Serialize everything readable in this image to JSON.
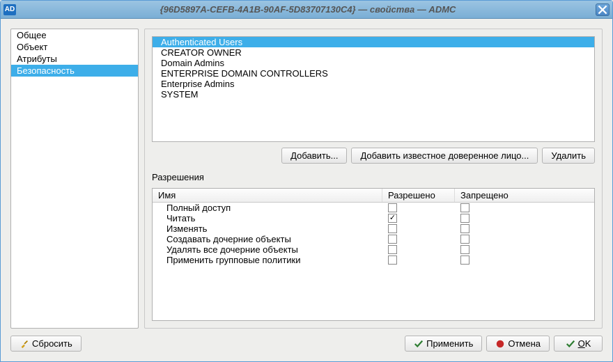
{
  "title": "{96D5897A-CEFB-4A1B-90AF-5D83707130C4} — свойства — ADMC",
  "app_icon_text": "AD",
  "sidebar": {
    "items": [
      {
        "label": "Общее",
        "selected": false
      },
      {
        "label": "Объект",
        "selected": false
      },
      {
        "label": "Атрибуты",
        "selected": false
      },
      {
        "label": "Безопасность",
        "selected": true
      }
    ]
  },
  "principals": [
    {
      "name": "Authenticated Users",
      "selected": true
    },
    {
      "name": "CREATOR OWNER",
      "selected": false
    },
    {
      "name": "Domain Admins",
      "selected": false
    },
    {
      "name": "ENTERPRISE DOMAIN CONTROLLERS",
      "selected": false
    },
    {
      "name": "Enterprise Admins",
      "selected": false
    },
    {
      "name": "SYSTEM",
      "selected": false
    }
  ],
  "principal_buttons": {
    "add": "Добавить...",
    "add_wellknown": "Добавить известное доверенное лицо...",
    "remove": "Удалить"
  },
  "permissions_label": "Разрешения",
  "perm_columns": {
    "name": "Имя",
    "allow": "Разрешено",
    "deny": "Запрещено"
  },
  "permissions": [
    {
      "name": "Полный доступ",
      "allow": false,
      "deny": false
    },
    {
      "name": "Читать",
      "allow": true,
      "deny": false
    },
    {
      "name": "Изменять",
      "allow": false,
      "deny": false
    },
    {
      "name": "Создавать дочерние объекты",
      "allow": false,
      "deny": false
    },
    {
      "name": "Удалять все дочерние объекты",
      "allow": false,
      "deny": false
    },
    {
      "name": "Применить групповые политики",
      "allow": false,
      "deny": false
    }
  ],
  "bottom": {
    "reset": "Сбросить",
    "apply": "Применить",
    "cancel": "Отмена",
    "ok": "OK"
  }
}
